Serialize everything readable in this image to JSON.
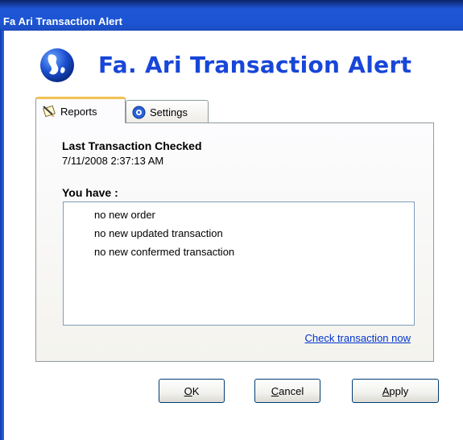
{
  "window": {
    "title": "Fa Ari Transaction Alert"
  },
  "header": {
    "app_name": "Fa. Ari Transaction Alert",
    "logo_icon": "globe-hand-icon"
  },
  "tabs": [
    {
      "label": "Reports",
      "icon": "pen-note-icon",
      "selected": true
    },
    {
      "label": "Settings",
      "icon": "gear-globe-icon",
      "selected": false
    }
  ],
  "reports": {
    "last_checked_label": "Last Transaction Checked",
    "last_checked_value": "7/11/2008 2:37:13 AM",
    "you_have_label": "You have :",
    "items": [
      "no new order",
      "no new updated transaction",
      "no new confermed transaction"
    ],
    "check_link": "Check transaction now"
  },
  "buttons": {
    "ok": {
      "mnemonic": "O",
      "rest": "K"
    },
    "cancel": {
      "mnemonic": "C",
      "rest": "ancel"
    },
    "apply": {
      "mnemonic": "A",
      "rest": "pply"
    }
  },
  "colors": {
    "heading": "#1846d8",
    "titlebar": "#1c55d4",
    "link": "#0033cc",
    "tab_highlight": "#f2c152"
  }
}
